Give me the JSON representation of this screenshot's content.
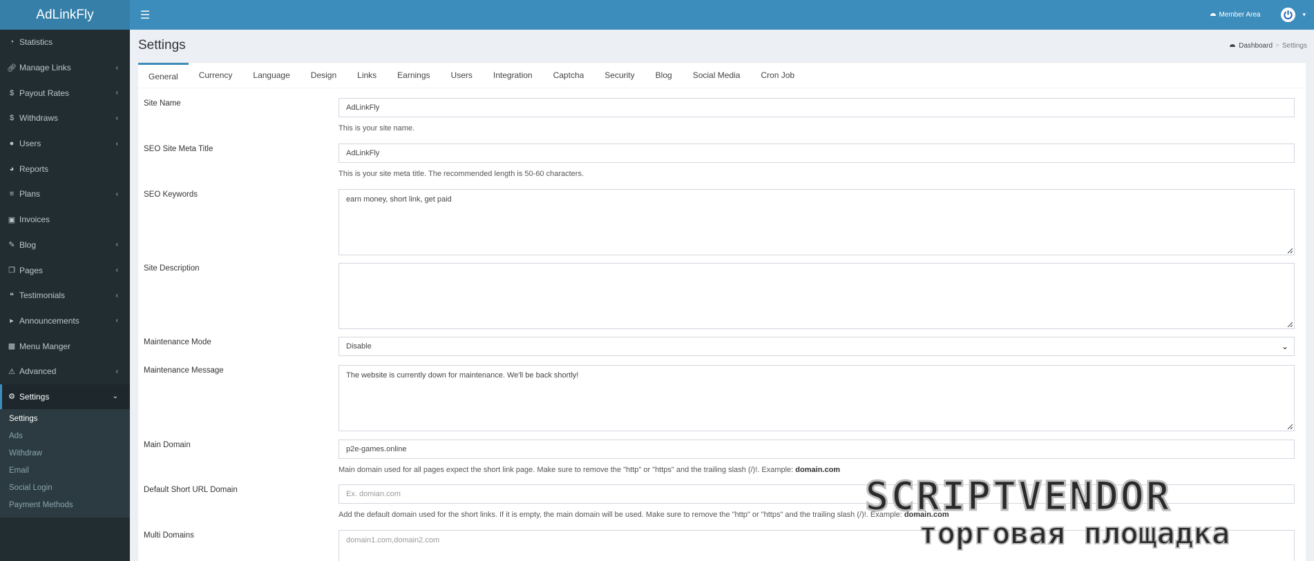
{
  "app": {
    "brand": "AdLinkFly"
  },
  "topbar": {
    "member_label": "Member Area"
  },
  "sidebar": {
    "items": [
      {
        "label": "Statistics",
        "icon": "dashboard-icon",
        "chevron": false
      },
      {
        "label": "Manage Links",
        "icon": "link-icon",
        "chevron": true
      },
      {
        "label": "Payout Rates",
        "icon": "dollar-icon",
        "chevron": true
      },
      {
        "label": "Withdraws",
        "icon": "dollar-icon",
        "chevron": true
      },
      {
        "label": "Users",
        "icon": "users-icon",
        "chevron": true
      },
      {
        "label": "Reports",
        "icon": "pie-chart-icon",
        "chevron": false
      },
      {
        "label": "Plans",
        "icon": "list-icon",
        "chevron": true
      },
      {
        "label": "Invoices",
        "icon": "credit-card-icon",
        "chevron": false
      },
      {
        "label": "Blog",
        "icon": "blog-icon",
        "chevron": true
      },
      {
        "label": "Pages",
        "icon": "pages-icon",
        "chevron": true
      },
      {
        "label": "Testimonials",
        "icon": "quote-icon",
        "chevron": true
      },
      {
        "label": "Announcements",
        "icon": "bullhorn-icon",
        "chevron": true
      },
      {
        "label": "Menu Manger",
        "icon": "menu-icon",
        "chevron": false
      },
      {
        "label": "Advanced",
        "icon": "warning-icon",
        "chevron": true
      },
      {
        "label": "Settings",
        "icon": "cogs-icon",
        "chevron": true
      }
    ],
    "settings_submenu": [
      "Settings",
      "Ads",
      "Withdraw",
      "Email",
      "Social Login",
      "Payment Methods"
    ]
  },
  "header": {
    "title": "Settings",
    "breadcrumb_home": "Dashboard",
    "breadcrumb_current": "Settings"
  },
  "tabs": [
    "General",
    "Currency",
    "Language",
    "Design",
    "Links",
    "Earnings",
    "Users",
    "Integration",
    "Captcha",
    "Security",
    "Blog",
    "Social Media",
    "Cron Job"
  ],
  "form": {
    "site_name": {
      "label": "Site Name",
      "value": "AdLinkFly",
      "help": "This is your site name."
    },
    "seo_title": {
      "label": "SEO Site Meta Title",
      "value": "AdLinkFly",
      "help": "This is your site meta title. The recommended length is 50-60 characters."
    },
    "seo_keywords": {
      "label": "SEO Keywords",
      "value": "earn money, short link, get paid"
    },
    "site_description": {
      "label": "Site Description",
      "value": ""
    },
    "maintenance_mode": {
      "label": "Maintenance Mode",
      "value": "Disable"
    },
    "maintenance_message": {
      "label": "Maintenance Message",
      "value": "The website is currently down for maintenance. We'll be back shortly!"
    },
    "main_domain": {
      "label": "Main Domain",
      "value": "p2e-games.online",
      "help": "Main domain used for all pages expect the short link page. Make sure to remove the \"http\" or \"https\" and the trailing slash (/)!. Example: ",
      "help_example": "domain.com"
    },
    "default_short_domain": {
      "label": "Default Short URL Domain",
      "placeholder": "Ex. domian.com",
      "help": "Add the default domain used for the short links. If it is empty, the main domain will be used. Make sure to remove the \"http\" or \"https\" and the trailing slash (/)!. Example: ",
      "help_example": "domain.com"
    },
    "multi_domains": {
      "label": "Multi Domains",
      "placeholder": "domain1.com,domain2.com"
    }
  },
  "watermark": {
    "line1": "SCRIPTVENDOR",
    "line2": "торговая площадка"
  },
  "colors": {
    "topbar": "#3c8dbc",
    "logo_bg": "#367fa9",
    "sidebar": "#222d32",
    "accent": "#3c8dbc"
  }
}
